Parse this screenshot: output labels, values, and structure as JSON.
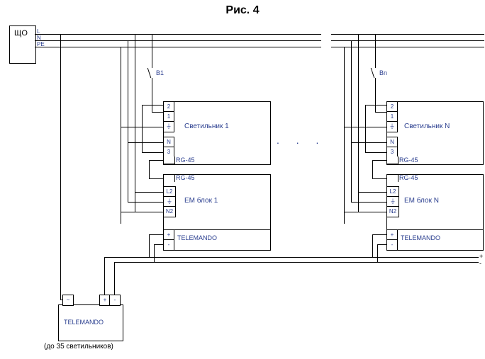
{
  "title": "Рис. 4",
  "source_box": {
    "label": "ЩО",
    "bus_lines": [
      "L",
      "N",
      "PE"
    ]
  },
  "telemando_main": {
    "label": "TELEMANDO",
    "top_terminals": [
      "~",
      "+",
      "-"
    ],
    "note": "(до 35 светильников)"
  },
  "units": [
    {
      "switch": "B1",
      "lamp": {
        "label": "Светильник 1",
        "terms_top": [
          "2",
          "1"
        ],
        "term_gnd": "⏚",
        "terms_bot": [
          "N",
          "3"
        ],
        "conn": "RG-45"
      },
      "em": {
        "conn": "RG-45",
        "terms": [
          "L2",
          "⏚",
          "N2"
        ],
        "label": "ЕМ блок 1",
        "tele": {
          "label": "TELEMANDO",
          "terms": [
            "+",
            "-"
          ]
        }
      }
    },
    {
      "switch": "Bn",
      "lamp": {
        "label": "Светильник N",
        "terms_top": [
          "2",
          "1"
        ],
        "term_gnd": "⏚",
        "terms_bot": [
          "N",
          "3"
        ],
        "conn": "RG-45"
      },
      "em": {
        "conn": "RG-45",
        "terms": [
          "L2",
          "⏚",
          "N2"
        ],
        "label": "ЕМ блок N",
        "tele": {
          "label": "TELEMANDO",
          "terms": [
            "+",
            "-"
          ]
        }
      }
    }
  ],
  "ellipsis": ". . .",
  "output": {
    "plus": "+",
    "minus": "-"
  },
  "chart_data": {
    "type": "wiring-diagram",
    "buses": [
      "L",
      "N",
      "PE"
    ],
    "nodes": [
      {
        "id": "ЩО",
        "type": "source",
        "feeds": [
          "L",
          "N",
          "PE"
        ]
      },
      {
        "id": "Светильник 1",
        "type": "luminaire",
        "terminals": [
          "2",
          "1",
          "GND",
          "N",
          "3"
        ],
        "data_port": "RG-45",
        "switch": "B1"
      },
      {
        "id": "ЕМ блок 1",
        "type": "emergency-block",
        "terminals": [
          "L2",
          "GND",
          "N2"
        ],
        "data_port": "RG-45",
        "telemando": [
          "+",
          "-"
        ]
      },
      {
        "id": "Светильник N",
        "type": "luminaire",
        "terminals": [
          "2",
          "1",
          "GND",
          "N",
          "3"
        ],
        "data_port": "RG-45",
        "switch": "Bn"
      },
      {
        "id": "ЕМ блок N",
        "type": "emergency-block",
        "terminals": [
          "L2",
          "GND",
          "N2"
        ],
        "data_port": "RG-45",
        "telemando": [
          "+",
          "-"
        ]
      },
      {
        "id": "TELEMANDO",
        "type": "controller",
        "terminals": [
          "~",
          "+",
          "-"
        ],
        "capacity_note": "до 35 светильников"
      }
    ],
    "repetition": "Units 1..N are connected identically in parallel to buses L/N/PE and to the TELEMANDO +/- loop",
    "output_bus": [
      "+",
      "-"
    ]
  }
}
